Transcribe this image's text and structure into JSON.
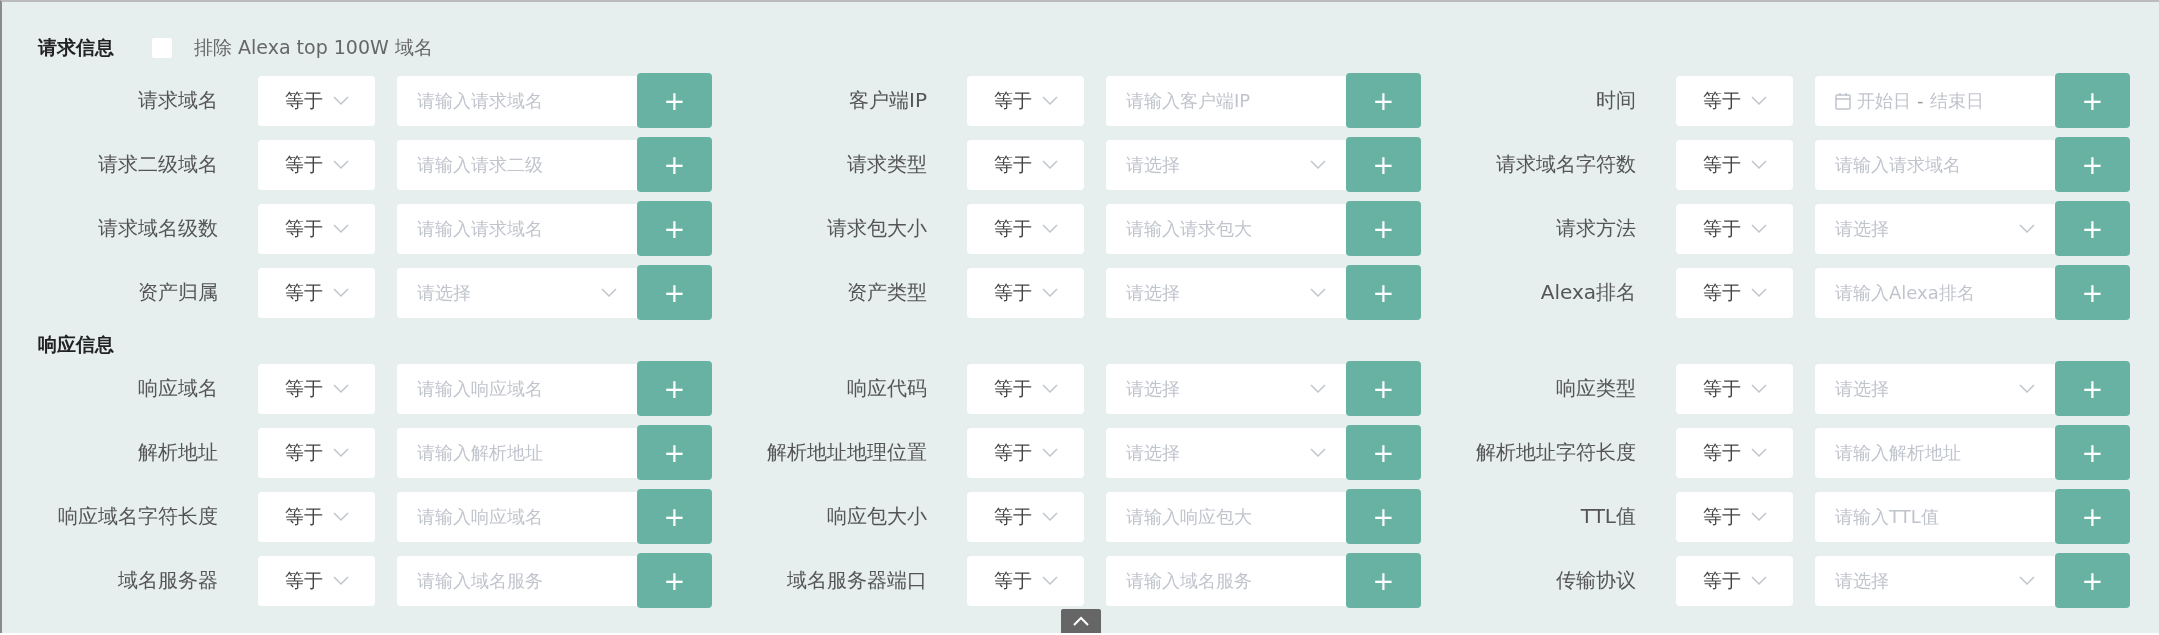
{
  "sections": [
    {
      "title": "请求信息",
      "checkbox": {
        "label": "排除 Alexa top 100W 域名",
        "checked": false
      },
      "fields": [
        {
          "label": "请求域名",
          "operator": "等于",
          "kind": "text",
          "placeholder": "请输入请求域名",
          "button": "+"
        },
        {
          "label": "客户端IP",
          "operator": "等于",
          "kind": "text",
          "placeholder": "请输入客户端IP",
          "button": "+"
        },
        {
          "label": "时间",
          "operator": "等于",
          "kind": "date-range",
          "start_placeholder": "开始日",
          "separator": "-",
          "end_placeholder": "结束日",
          "button": "+"
        },
        {
          "label": "请求二级域名",
          "operator": "等于",
          "kind": "text",
          "placeholder": "请输入请求二级",
          "button": "+"
        },
        {
          "label": "请求类型",
          "operator": "等于",
          "kind": "select",
          "placeholder": "请选择",
          "button": "+"
        },
        {
          "label": "请求域名字符数",
          "operator": "等于",
          "kind": "text",
          "placeholder": "请输入请求域名",
          "button": "+"
        },
        {
          "label": "请求域名级数",
          "operator": "等于",
          "kind": "text",
          "placeholder": "请输入请求域名",
          "button": "+"
        },
        {
          "label": "请求包大小",
          "operator": "等于",
          "kind": "text",
          "placeholder": "请输入请求包大",
          "button": "+"
        },
        {
          "label": "请求方法",
          "operator": "等于",
          "kind": "select",
          "placeholder": "请选择",
          "button": "+"
        },
        {
          "label": "资产归属",
          "operator": "等于",
          "kind": "select",
          "placeholder": "请选择",
          "button": "+"
        },
        {
          "label": "资产类型",
          "operator": "等于",
          "kind": "select",
          "placeholder": "请选择",
          "button": "+"
        },
        {
          "label": "Alexa排名",
          "operator": "等于",
          "kind": "text",
          "placeholder": "请输入Alexa排名",
          "button": "+"
        }
      ]
    },
    {
      "title": "响应信息",
      "fields": [
        {
          "label": "响应域名",
          "operator": "等于",
          "kind": "text",
          "placeholder": "请输入响应域名",
          "button": "+"
        },
        {
          "label": "响应代码",
          "operator": "等于",
          "kind": "select",
          "placeholder": "请选择",
          "button": "+"
        },
        {
          "label": "响应类型",
          "operator": "等于",
          "kind": "select",
          "placeholder": "请选择",
          "button": "+"
        },
        {
          "label": "解析地址",
          "operator": "等于",
          "kind": "text",
          "placeholder": "请输入解析地址",
          "button": "+"
        },
        {
          "label": "解析地址地理位置",
          "operator": "等于",
          "kind": "select",
          "placeholder": "请选择",
          "button": "+"
        },
        {
          "label": "解析地址字符长度",
          "operator": "等于",
          "kind": "text",
          "placeholder": "请输入解析地址",
          "button": "+"
        },
        {
          "label": "响应域名字符长度",
          "operator": "等于",
          "kind": "text",
          "placeholder": "请输入响应域名",
          "button": "+"
        },
        {
          "label": "响应包大小",
          "operator": "等于",
          "kind": "text",
          "placeholder": "请输入响应包大",
          "button": "+"
        },
        {
          "label": "TTL值",
          "operator": "等于",
          "kind": "text",
          "placeholder": "请输入TTL值",
          "button": "+"
        },
        {
          "label": "域名服务器",
          "operator": "等于",
          "kind": "text",
          "placeholder": "请输入域名服务",
          "button": "+"
        },
        {
          "label": "域名服务器端口",
          "operator": "等于",
          "kind": "text",
          "placeholder": "请输入域名服务",
          "button": "+"
        },
        {
          "label": "传输协议",
          "operator": "等于",
          "kind": "select",
          "placeholder": "请选择",
          "button": "+"
        }
      ]
    }
  ]
}
